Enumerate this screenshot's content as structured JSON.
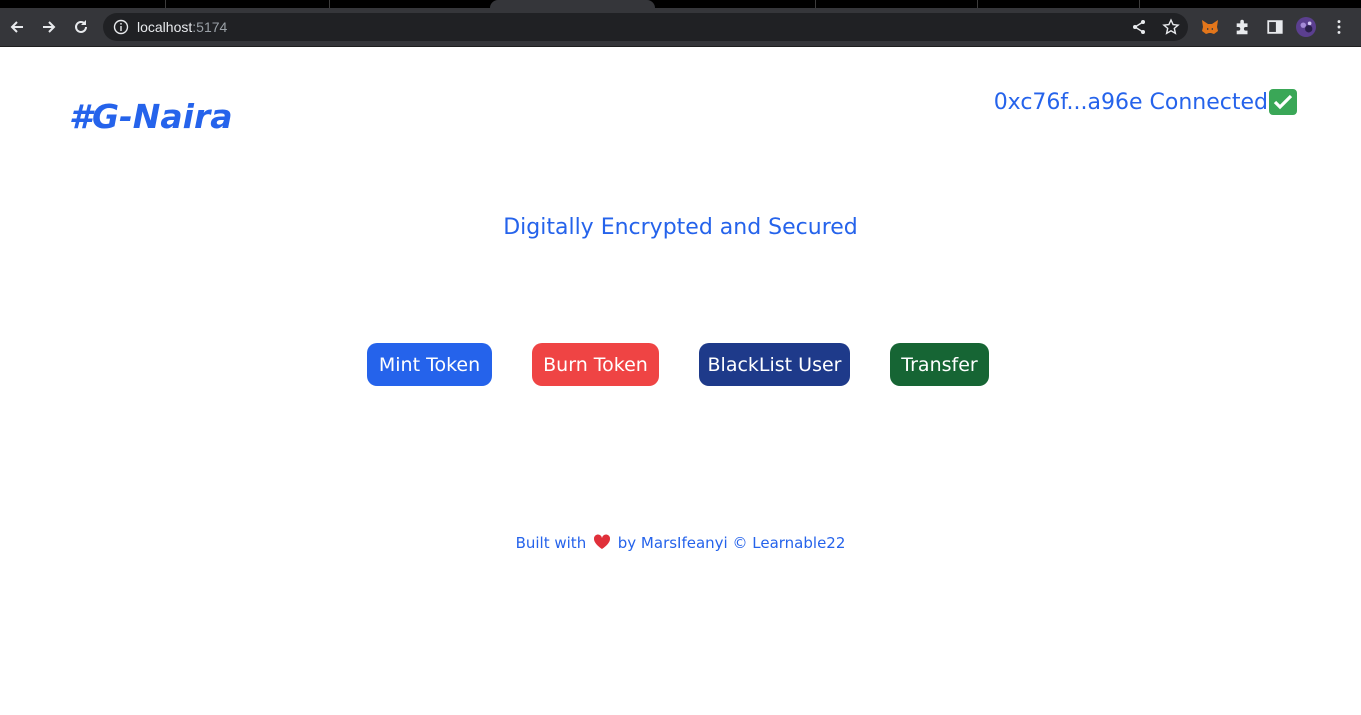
{
  "browser": {
    "url_host": "localhost",
    "url_port": ":5174"
  },
  "header": {
    "brand": "#G-Naira",
    "wallet_status": "0xc76f...a96e Connected"
  },
  "main": {
    "tagline": "Digitally Encrypted and Secured",
    "buttons": {
      "mint": "Mint Token",
      "burn": "Burn Token",
      "blacklist": "BlackList User",
      "transfer": "Transfer"
    }
  },
  "footer": {
    "built_with": "Built with",
    "by_text": "by MarsIfeanyi © Learnable22"
  },
  "colors": {
    "brand_blue": "#2563eb",
    "burn_red": "#ef4444",
    "blacklist_navy": "#1e3a8a",
    "transfer_green": "#166534"
  }
}
